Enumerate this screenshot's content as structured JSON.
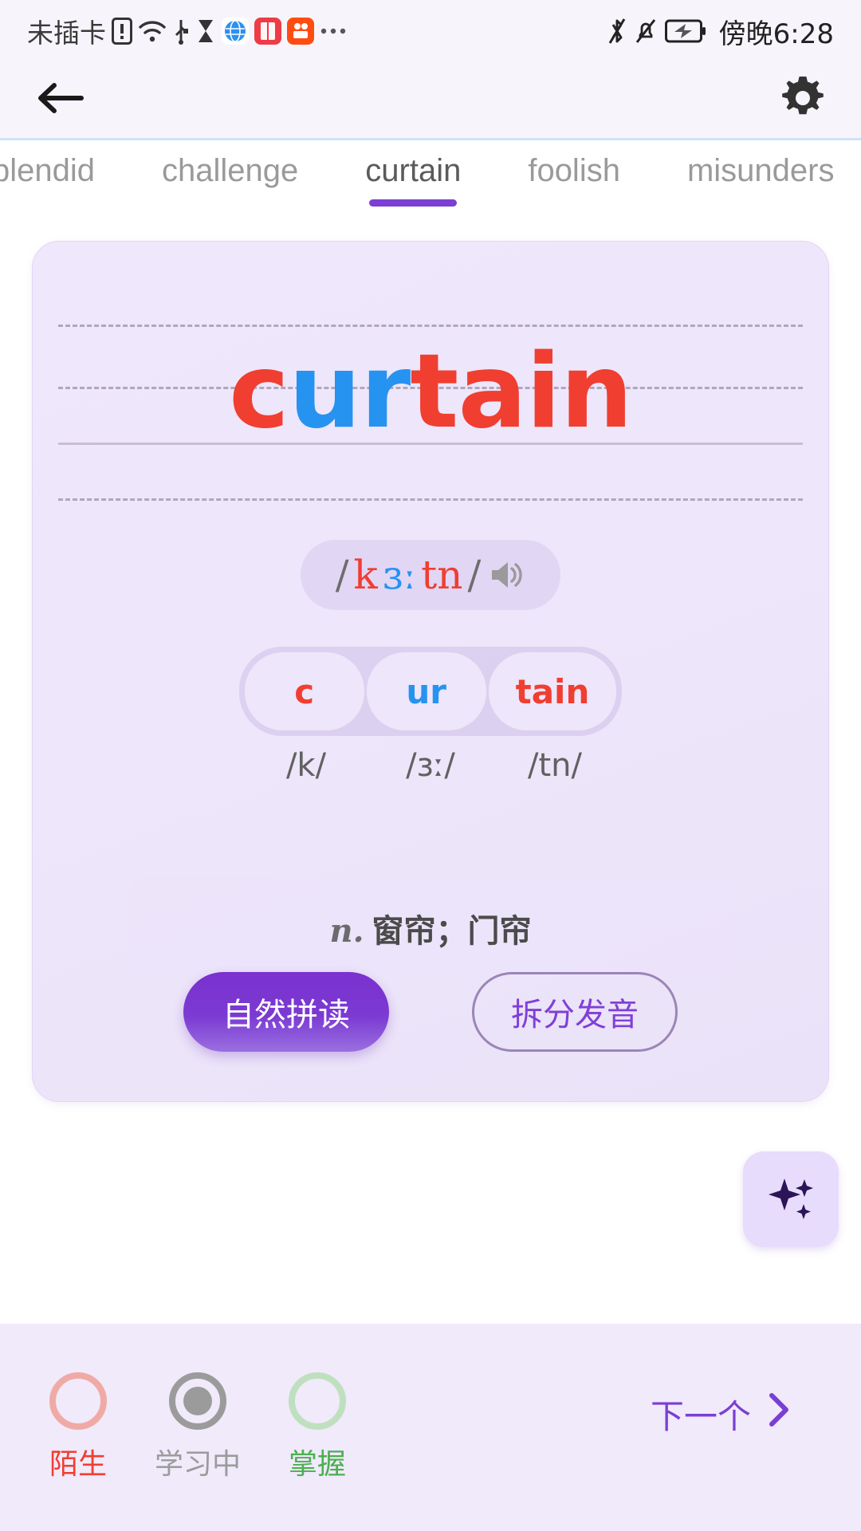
{
  "statusbar": {
    "sim_text": "未插卡",
    "icons": [
      "sim-alert-icon",
      "wifi-icon",
      "usb-icon",
      "hourglass-icon",
      "browser-app-icon",
      "book-app-icon",
      "video-app-icon",
      "more-icon"
    ],
    "right_icons": [
      "bluetooth-icon",
      "notification-muted-icon",
      "battery-charging-icon"
    ],
    "time": "傍晚6:28"
  },
  "appbar": {
    "back_icon": "arrow-left-icon",
    "settings_icon": "gear-icon"
  },
  "tabs": [
    {
      "label": "plendid",
      "active": false
    },
    {
      "label": "challenge",
      "active": false
    },
    {
      "label": "curtain",
      "active": true
    },
    {
      "label": "foolish",
      "active": false
    },
    {
      "label": "misunders",
      "active": false
    }
  ],
  "card": {
    "word": "curtain",
    "word_segments": [
      {
        "text": "c",
        "color": "red"
      },
      {
        "text": "ur",
        "color": "blue"
      },
      {
        "text": "t",
        "color": "red"
      },
      {
        "text": "ain",
        "color": "red"
      }
    ],
    "phonetic": {
      "open_slash": "/",
      "part1": "k",
      "part2": "ɜː",
      "part3": "tn",
      "close_slash": "/",
      "speaker_icon": "speaker-icon"
    },
    "syllables": [
      {
        "text": "c",
        "color": "red",
        "phoneme": "/k/"
      },
      {
        "text": "ur",
        "color": "blue",
        "phoneme": "/ɜː/"
      },
      {
        "text": "tain",
        "color": "red",
        "phoneme": "/tn/"
      }
    ],
    "definition": {
      "pos": "n.",
      "meaning": "窗帘；门帘"
    },
    "buttons": {
      "primary": "自然拼读",
      "outline": "拆分发音"
    },
    "fab_icon": "sparkle-icon"
  },
  "bottom": {
    "statuses": [
      {
        "label": "陌生",
        "state": "unselected",
        "color": "#f03e31"
      },
      {
        "label": "学习中",
        "state": "selected",
        "color": "#9b9b9b"
      },
      {
        "label": "掌握",
        "state": "unselected",
        "color": "#4caf50"
      }
    ],
    "next_label": "下一个",
    "next_icon": "chevron-right-icon"
  },
  "colors": {
    "accent_purple": "#7c3fd4",
    "red": "#f03e31",
    "blue": "#2693f0",
    "card_bg": "#eee6fa"
  }
}
